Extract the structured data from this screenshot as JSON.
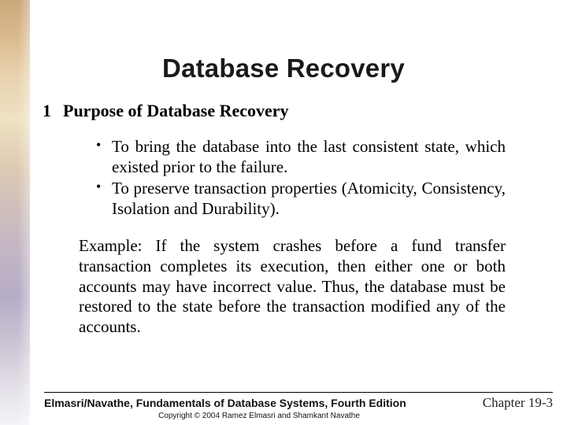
{
  "title": "Database Recovery",
  "section": {
    "number": "1",
    "heading": "Purpose of Database Recovery"
  },
  "bullets": [
    "To bring the database into the last consistent state, which existed prior to the failure.",
    "To preserve transaction properties (Atomicity, Consistency, Isolation and Durability)."
  ],
  "example": "Example:  If the system crashes before a fund transfer transaction completes its execution, then either one or both accounts may have incorrect value.  Thus, the database must be restored to the state before the transaction modified any of the accounts.",
  "footer": {
    "book": "Elmasri/Navathe, Fundamentals of Database Systems, Fourth Edition",
    "page": "Chapter 19-3",
    "copyright": "Copyright © 2004 Ramez Elmasri and Shamkant Navathe"
  }
}
